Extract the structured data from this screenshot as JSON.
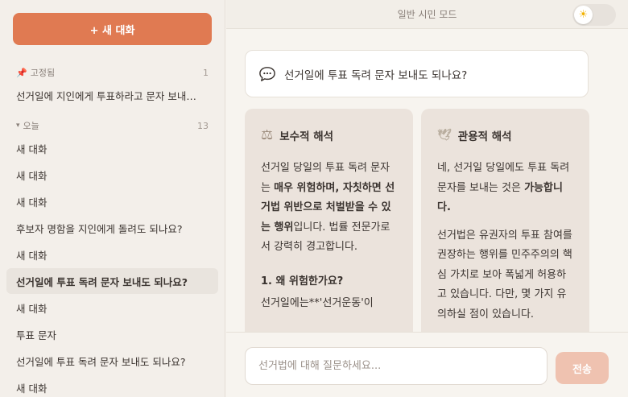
{
  "sidebar": {
    "new_chat_label": "+ 새 대화",
    "pinned": {
      "label": "고정됨",
      "count": "1"
    },
    "pinned_items": [
      {
        "label": "선거일에 지인에게 투표하라고 문자 보내…"
      }
    ],
    "today": {
      "label": "오늘",
      "count": "13"
    },
    "today_items": [
      {
        "label": "새 대화"
      },
      {
        "label": "새 대화"
      },
      {
        "label": "새 대화"
      },
      {
        "label": "후보자 명함을 지인에게 돌려도 되나요?"
      },
      {
        "label": "새 대화"
      },
      {
        "label": "선거일에 투표 독려 문자 보내도 되나요?"
      },
      {
        "label": "새 대화"
      },
      {
        "label": "투표 문자"
      },
      {
        "label": "선거일에 투표 독려 문자 보내도 되나요?"
      },
      {
        "label": "새 대화"
      }
    ]
  },
  "header": {
    "mode_title": "일반 시민 모드"
  },
  "question": {
    "text": "선거일에 투표 독려 문자 보내도 되나요?"
  },
  "conservative": {
    "title": "보수적 해석",
    "p1_a": "선거일 당일의 투표 독려 문자는 ",
    "p1_b": "매우 위험하며, 자칫하면 선거법 위반으로 처벌받을 수 있는 행위",
    "p1_c": "입니다. 법률 전문가로서 강력히 경고합니다.",
    "heading": "1. 왜 위험한가요?",
    "p2": "선거일에는**'선거운동'이"
  },
  "lenient": {
    "title": "관용적 해석",
    "p1_a": "네, 선거일 당일에도 투표 독려 문자를 보내는 것은 ",
    "p1_b": "가능합니다.",
    "p2": "선거법은 유권자의 투표 참여를 권장하는 행위를 민주주의의 핵심 가치로 보아 폭넓게 허용하고 있습니다. 다만, 몇 가지 유의하실 점이 있습니다."
  },
  "composer": {
    "placeholder": "선거법에 대해 질문하세요...",
    "send_label": "전송"
  },
  "colors": {
    "accent": "#e07a52",
    "send_disabled": "#efc2b0",
    "card_bg": "#ebe3dc"
  },
  "icons": {
    "pin": "pushpin-icon",
    "caret": "caret-down-icon",
    "theme": "sun-icon",
    "question": "speech-bubble-icon",
    "conservative": "balance-scale-icon",
    "lenient": "dove-icon"
  }
}
